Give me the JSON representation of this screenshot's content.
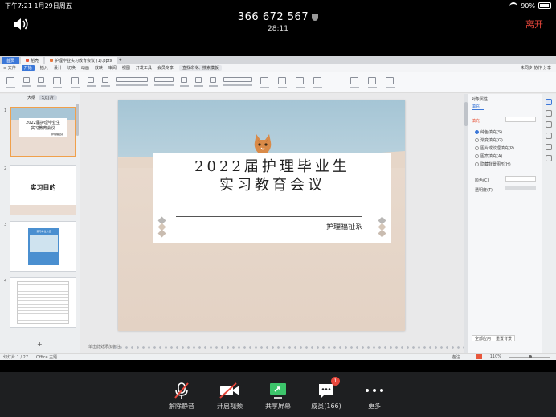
{
  "status_bar": {
    "time_date": "下午7:21   1月29日周五",
    "battery": "90%"
  },
  "meeting": {
    "id": "366 672 567",
    "timer": "28:11",
    "leave_label": "离开"
  },
  "app": {
    "tabs": [
      {
        "label": "首页"
      },
      {
        "label": "稻壳"
      },
      {
        "label": "护理毕业实习教育会议 (1).pptx"
      }
    ],
    "new_tab": "+",
    "menu": {
      "file": "≡ 文件",
      "items": [
        "开始",
        "插入",
        "设计",
        "切换",
        "动画",
        "放映",
        "审阅",
        "视图",
        "开发工具",
        "会员专享"
      ],
      "search": "查找命令、搜索模板",
      "tail": "未同步  协作  分享"
    },
    "thumb_panel": {
      "tabs": [
        "大纲",
        "幻灯片"
      ],
      "slides": [
        {
          "num": "1",
          "line1": "2022届护理毕业生",
          "line2": "实习教育会议",
          "sub": "护理福祉系"
        },
        {
          "num": "2",
          "title": "实习目的"
        },
        {
          "num": "3",
          "caption": "实习单位介绍"
        },
        {
          "num": "4"
        }
      ],
      "add_label": "+"
    },
    "slide": {
      "title_line1": "2022届护理毕业生",
      "title_line2": "实习教育会议",
      "department": "护理福祉系"
    },
    "notes_hint": "单击此处添加备注",
    "properties": {
      "title": "对象属性",
      "tab": "填充",
      "section": "填充",
      "options": [
        "纯色填充(S)",
        "渐变填充(G)",
        "图片或纹理填充(P)",
        "图案填充(A)",
        "隐藏背景图形(H)"
      ],
      "color_label": "颜色(C)",
      "transparency_label": "透明度(T)",
      "apply_all": "全部应用",
      "reset": "重置背景"
    },
    "status": {
      "slide_count": "幻灯片 1 / 27",
      "theme": "Office 主题",
      "notes": "备注",
      "zoom": "110%"
    }
  },
  "toolbar": {
    "items": [
      {
        "label": "解除静音"
      },
      {
        "label": "开启视频"
      },
      {
        "label": "共享屏幕"
      },
      {
        "label": "成员(166)",
        "badge": "1"
      },
      {
        "label": "更多"
      }
    ]
  },
  "colors": {
    "accent_blue": "#3b77d8",
    "leave_red": "#e8473c",
    "share_green": "#3cc46a"
  }
}
